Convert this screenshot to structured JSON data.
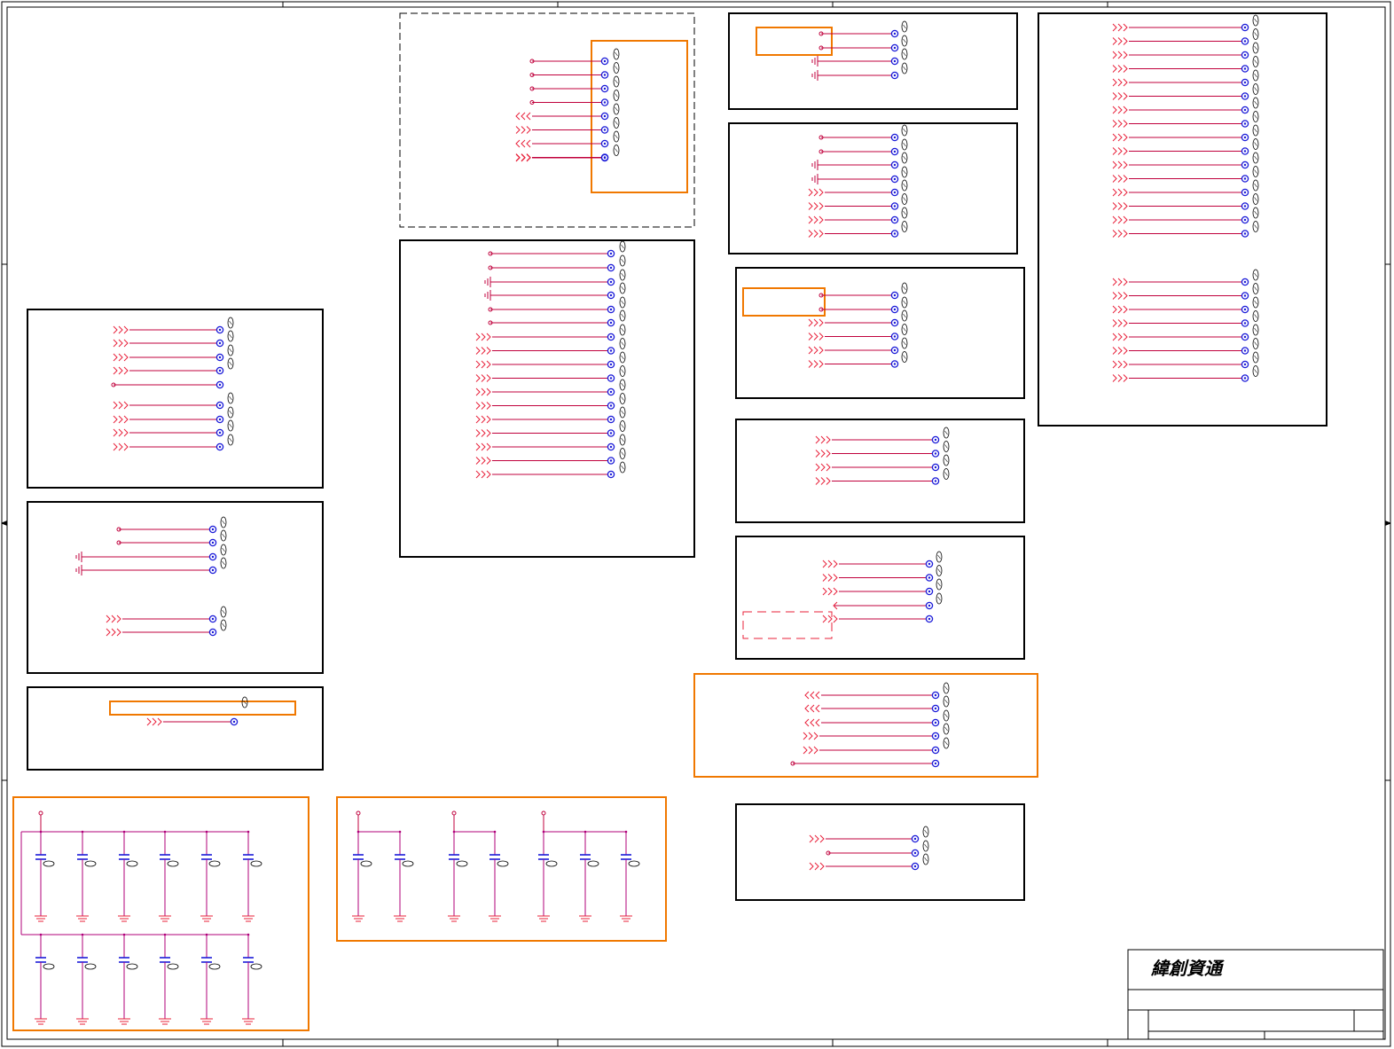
{
  "sheet": {
    "company_name": "緯創資通",
    "colors": {
      "net_wire": "#c0003c",
      "pin_blue": "#1a1ad8",
      "offpage_red": "#e8203a",
      "highlight_orange": "#f07800",
      "frame_black": "#000000",
      "cap_magenta": "#b0007a"
    }
  }
}
